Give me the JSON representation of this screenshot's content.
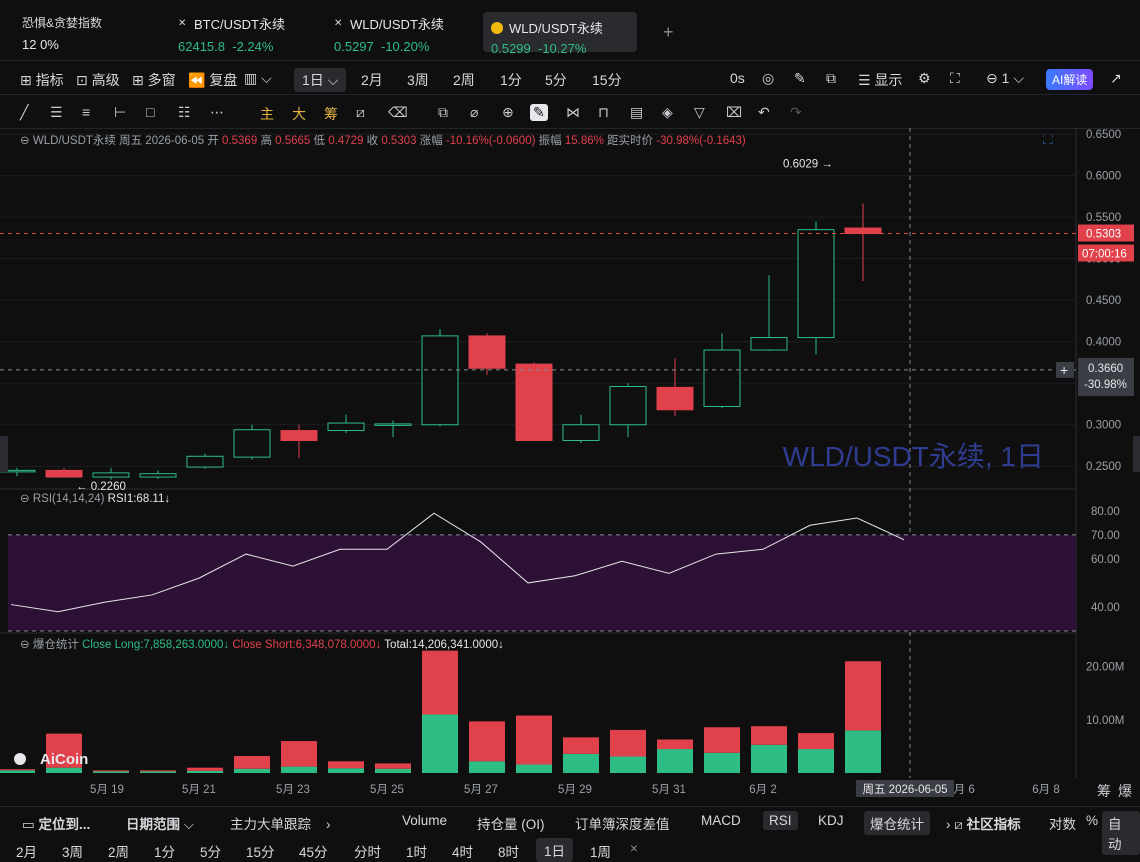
{
  "header": {
    "fear_greed": {
      "title": "恐惧&贪婪指数",
      "value": "12 0%"
    },
    "tickers": [
      {
        "name": "BTC/USDT永续",
        "price": "62415.8",
        "change": "-2.24%"
      },
      {
        "name": "WLD/USDT永续",
        "price": "0.5297",
        "change": "-10.20%"
      },
      {
        "name": "WLD/USDT永续",
        "price": "0.5299",
        "change": "-10.27%"
      }
    ],
    "add_tab": "+"
  },
  "toolbar": {
    "indicators": "指标",
    "advanced": "高级",
    "multi_window": "多窗",
    "replay": "复盘",
    "timeframes": [
      "1日",
      "2月",
      "3周",
      "2周",
      "1分",
      "5分",
      "15分"
    ],
    "countdown": "0s",
    "display": "显示",
    "layout_count": "1",
    "ai": "AI解读"
  },
  "drawbar": {
    "main": "主",
    "big": "大",
    "chip": "筹"
  },
  "legend": {
    "symbol": "WLD/USDT永续",
    "day": "周五 2026-06-05",
    "open_label": "开",
    "open": "0.5369",
    "high_label": "高",
    "high": "0.5665",
    "low_label": "低",
    "low": "0.4729",
    "close_label": "收",
    "close": "0.5303",
    "chg_label": "涨幅",
    "chg": "-10.16%(-0.0600)",
    "amp_label": "振幅",
    "amp": "15.86%",
    "dist_label": "距实时价",
    "dist": "-30.98%(-0.1643)"
  },
  "rsi_legend": {
    "name": "RSI(14,14,24)",
    "value": "RSI1:68.11↓"
  },
  "liq_legend": {
    "name": "爆仓统计",
    "long": "Close Long:7,858,263.0000↓",
    "short": "Close Short:6,348,078.0000↓",
    "total": "Total:14,206,341.0000↓"
  },
  "watermark": "WLD/USDT永续, 1日",
  "brand": "AiCoin",
  "price_tags": {
    "last": "0.5303",
    "countdown": "07:00:16",
    "cursor": "0.3660",
    "cursor_pct": "-30.98%"
  },
  "crosshair_date": "周五 2026-06-05",
  "corner_labels": {
    "chip": "筹",
    "burst": "爆"
  },
  "chart_data": [
    {
      "type": "candlestick",
      "x": [
        "5/18",
        "5/19",
        "5/20",
        "5/21",
        "5/22",
        "5/23",
        "5/24",
        "5/25",
        "5/26",
        "5/27",
        "5/28",
        "5/29",
        "5/30",
        "5/31",
        "6/1",
        "6/2",
        "6/3",
        "6/4",
        "6/5"
      ],
      "open": [
        0.245,
        0.245,
        0.237,
        0.237,
        0.249,
        0.261,
        0.293,
        0.293,
        0.3,
        0.3,
        0.407,
        0.373,
        0.281,
        0.3,
        0.345,
        0.322,
        0.39,
        0.405,
        0.5369
      ],
      "high": [
        0.248,
        0.248,
        0.248,
        0.245,
        0.265,
        0.3,
        0.3,
        0.312,
        0.305,
        0.415,
        0.41,
        0.375,
        0.312,
        0.35,
        0.38,
        0.41,
        0.48,
        0.545,
        0.5665
      ],
      "low": [
        0.238,
        0.236,
        0.234,
        0.235,
        0.247,
        0.258,
        0.26,
        0.29,
        0.285,
        0.298,
        0.36,
        0.281,
        0.278,
        0.285,
        0.31,
        0.32,
        0.389,
        0.385,
        0.4729
      ],
      "close": [
        0.245,
        0.237,
        0.242,
        0.241,
        0.262,
        0.294,
        0.281,
        0.302,
        0.301,
        0.407,
        0.368,
        0.281,
        0.3,
        0.346,
        0.318,
        0.39,
        0.405,
        0.535,
        0.5303
      ],
      "y_ticks": [
        "0.6500",
        "0.6000",
        "0.5500",
        "0.5000",
        "0.4500",
        "0.4000",
        "0.3500",
        "0.3000",
        "0.2500"
      ],
      "ylim": [
        0.225,
        0.655
      ],
      "annotations": [
        {
          "text": "0.6029 →",
          "value": 0.6029
        },
        {
          "text": "← 0.2260",
          "value": 0.226
        }
      ]
    },
    {
      "type": "line",
      "name": "RSI1",
      "values": [
        41,
        38,
        42,
        45,
        52,
        62,
        57,
        64,
        64,
        79,
        67,
        50,
        53,
        59,
        54,
        62,
        64,
        74,
        77,
        68
      ],
      "y_ticks": [
        "80.00",
        "70.00",
        "60.00",
        "40.00"
      ],
      "ylim": [
        30,
        87
      ],
      "band": [
        30,
        70
      ]
    },
    {
      "type": "bar",
      "x": [
        "5/18",
        "5/19",
        "5/20",
        "5/21",
        "5/22",
        "5/23",
        "5/24",
        "5/25",
        "5/26",
        "5/27",
        "5/28",
        "5/29",
        "5/30",
        "5/31",
        "6/1",
        "6/2",
        "6/3",
        "6/4",
        "6/5"
      ],
      "series": [
        {
          "name": "Close Long",
          "values": [
            0.5,
            1.0,
            0.3,
            0.3,
            0.4,
            0.8,
            1.2,
            0.9,
            0.8,
            11.0,
            2.2,
            1.6,
            3.6,
            3.1,
            4.5,
            3.8,
            5.3,
            4.5,
            8.0
          ]
        },
        {
          "name": "Close Short",
          "values": [
            0.2,
            6.4,
            0.2,
            0.2,
            0.6,
            2.4,
            4.8,
            1.3,
            1.0,
            12.0,
            7.5,
            9.2,
            3.1,
            5.0,
            1.8,
            4.8,
            3.5,
            3.0,
            13.0
          ]
        }
      ],
      "y_ticks": [
        "20.00M",
        "10.00M"
      ],
      "ylim": [
        0,
        25
      ]
    }
  ],
  "date_ticks": [
    "5月 19",
    "5月 21",
    "5月 23",
    "5月 25",
    "5月 27",
    "5月 29",
    "5月 31",
    "6月 2",
    "6月 4",
    "6月 6",
    "6月 8"
  ],
  "bottom_tabs": {
    "locate": "定位到...",
    "date_range": "日期范围",
    "main_force": "主力大单跟踪",
    "indicators": [
      "Volume",
      "持仓量 (OI)",
      "订单簿深度差值",
      "MACD",
      "RSI",
      "KDJ",
      "爆仓统计"
    ],
    "community": "社区指标",
    "log": "对数",
    "pct": "%",
    "auto": "自动"
  },
  "period_tabs": [
    "2月",
    "3周",
    "2周",
    "1分",
    "5分",
    "15分",
    "45分",
    "分时",
    "1时",
    "4时",
    "8时",
    "1日",
    "1周"
  ],
  "period_close": "×"
}
